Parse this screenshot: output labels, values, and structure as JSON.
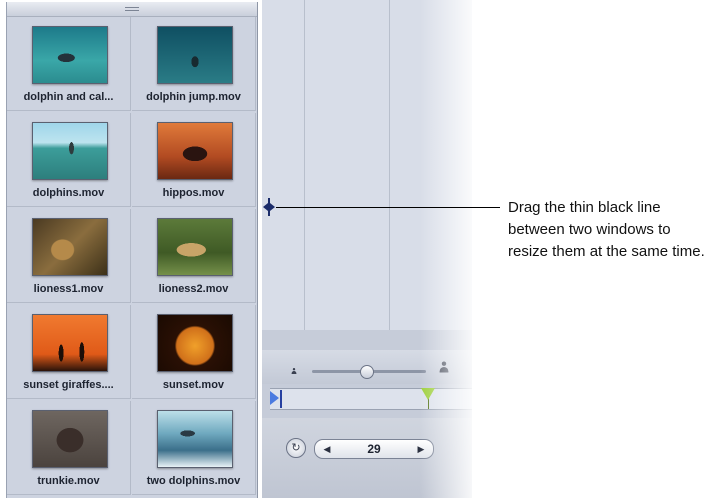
{
  "browser": {
    "clips": [
      {
        "name": "dolphin and cal...",
        "thumb": "underwater-dolphin"
      },
      {
        "name": "dolphin jump.mov",
        "thumb": "underwater-dolphin-dark"
      },
      {
        "name": "dolphins.mov",
        "thumb": "dolphin-leaping-sea"
      },
      {
        "name": "hippos.mov",
        "thumb": "hippos-silhouette"
      },
      {
        "name": "lioness1.mov",
        "thumb": "lion-face"
      },
      {
        "name": "lioness2.mov",
        "thumb": "lioness-resting"
      },
      {
        "name": "sunset giraffes....",
        "thumb": "giraffes-sunset"
      },
      {
        "name": "sunset.mov",
        "thumb": "sunset-sun"
      },
      {
        "name": "trunkie.mov",
        "thumb": "elephant"
      },
      {
        "name": "two dolphins.mov",
        "thumb": "dolphins-waves"
      }
    ]
  },
  "controls": {
    "zoom_level": 0.47,
    "playhead_position": 0.78,
    "frame_value": "29",
    "step_back_icon": "◀",
    "step_forward_icon": "▶",
    "loop_icon": "↻"
  },
  "callout": {
    "text": "Drag the thin black line between two windows to resize them at the same time."
  }
}
